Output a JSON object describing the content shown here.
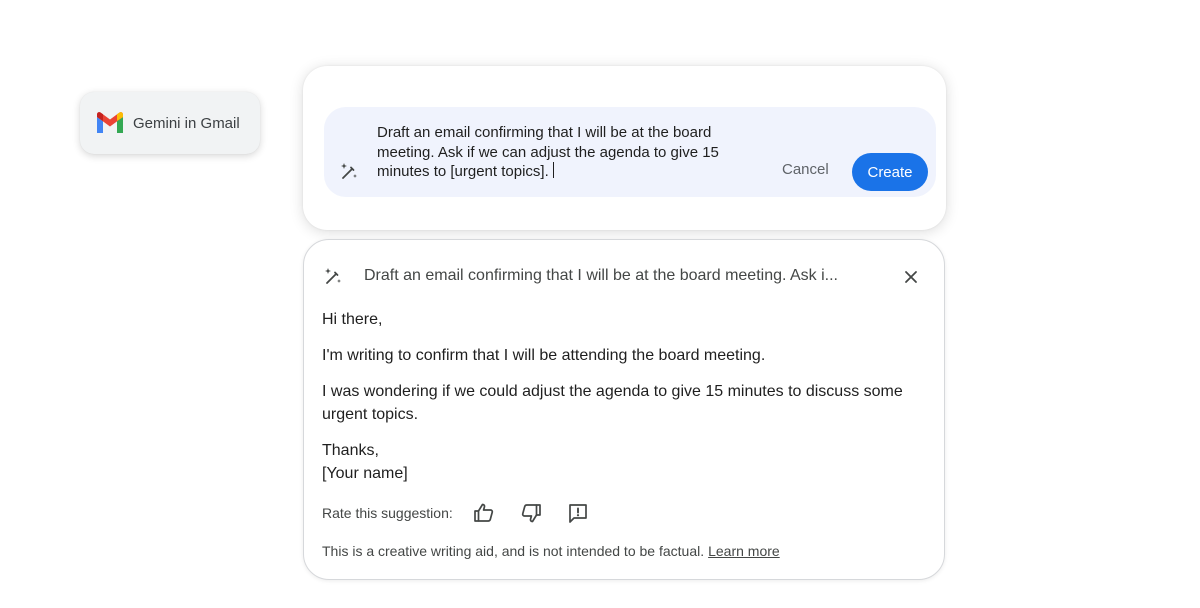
{
  "chip": {
    "label": "Gemini in Gmail",
    "icon": "gmail-logo"
  },
  "prompt": {
    "text": "Draft an email confirming that I will be at the board meeting. Ask if we can adjust the agenda to give 15 minutes to [urgent topics].",
    "icon": "magic-pen-icon",
    "cancel_label": "Cancel",
    "create_label": "Create",
    "accent_color": "#1a73e8"
  },
  "result": {
    "title": "Draft an email confirming that I will be at the board meeting. Ask i...",
    "icon": "magic-pen-icon",
    "close_icon": "close-icon",
    "greeting": "Hi there,",
    "paragraph_1": "I'm writing to confirm that I will be attending the board meeting.",
    "paragraph_2": "I was wondering if we could adjust the agenda to give 15 minutes to discuss some urgent topics.",
    "signoff": "Thanks,",
    "signature": "[Your name]",
    "rate_label": "Rate this suggestion:",
    "rate_icons": [
      "thumbs-up-icon",
      "thumbs-down-icon",
      "report-icon"
    ],
    "disclaimer": "This is a creative writing aid, and is not intended to be factual.",
    "learn_more": "Learn more"
  }
}
